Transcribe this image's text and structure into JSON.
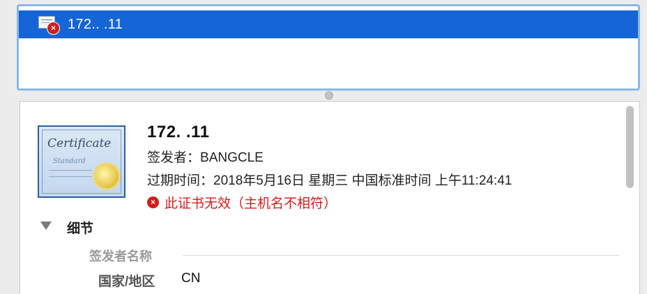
{
  "certificate_list": {
    "selected_row_label": "172..  .11"
  },
  "details": {
    "title": "172.   .11",
    "issuer_label": "签发者：",
    "issuer_value": "BANGCLE",
    "expiry_label": "过期时间：",
    "expiry_value": "2018年5月16日 星期三 中国标准时间 上午11:24:41",
    "error_text": "此证书无效（主机名不相符）",
    "section_title": "细节",
    "group_label": "签发者名称",
    "fields": [
      {
        "label": "国家/地区",
        "value": "CN"
      }
    ],
    "certificate_image": {
      "line1": "Certificate",
      "line2": "Standard"
    }
  },
  "icons": {
    "row_icon": "certificate-error-icon",
    "error_icon": "error-x-icon",
    "disclosure": "disclosure-triangle-down-icon",
    "image": "certificate-standard-icon"
  },
  "colors": {
    "selection": "#1565d6",
    "error": "#d41b1b",
    "list_border": "#88b7e9"
  }
}
